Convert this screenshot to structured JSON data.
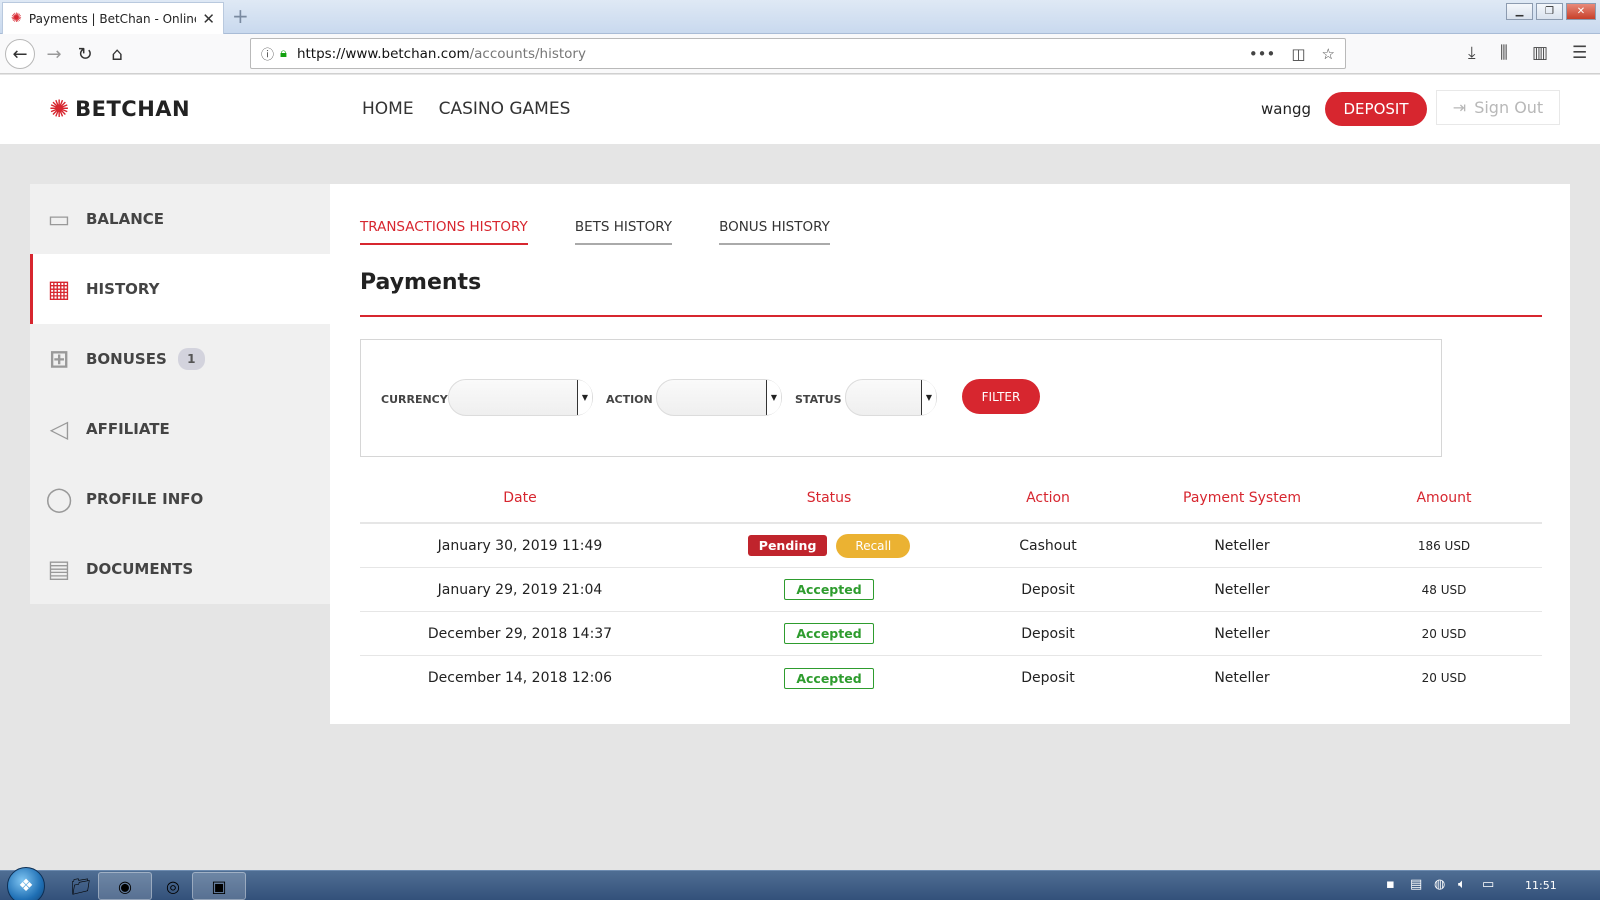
{
  "browser": {
    "tab_title": "Payments | BetChan - Online C",
    "url_domain": "https://www.betchan.com",
    "url_path": "/accounts/history"
  },
  "header": {
    "logo_text": "BETCHAN",
    "nav": [
      "HOME",
      "CASINO GAMES"
    ],
    "username": "wangg",
    "deposit_label": "DEPOSIT",
    "signout_label": "Sign Out"
  },
  "sidebar": {
    "items": [
      {
        "label": "BALANCE",
        "icon": "wallet-icon",
        "active": false
      },
      {
        "label": "HISTORY",
        "icon": "calendar-clock-icon",
        "active": true
      },
      {
        "label": "BONUSES",
        "icon": "gift-icon",
        "badge": "1",
        "active": false
      },
      {
        "label": "AFFILIATE",
        "icon": "megaphone-icon",
        "active": false
      },
      {
        "label": "PROFILE INFO",
        "icon": "user-icon",
        "active": false
      },
      {
        "label": "DOCUMENTS",
        "icon": "id-card-icon",
        "active": false
      }
    ]
  },
  "main": {
    "tabs": [
      {
        "label": "TRANSACTIONS HISTORY",
        "active": true
      },
      {
        "label": "BETS HISTORY",
        "active": false
      },
      {
        "label": "BONUS HISTORY",
        "active": false
      }
    ],
    "title": "Payments",
    "filters": {
      "currency_label": "CURRENCY",
      "action_label": "ACTION",
      "status_label": "STATUS",
      "filter_button": "FILTER"
    },
    "table": {
      "headers": [
        "Date",
        "Status",
        "Action",
        "Payment System",
        "Amount"
      ],
      "rows": [
        {
          "date": "January 30, 2019 11:49",
          "status": "Pending",
          "recall": "Recall",
          "action": "Cashout",
          "system": "Neteller",
          "amount": "186 USD"
        },
        {
          "date": "January 29, 2019 21:04",
          "status": "Accepted",
          "action": "Deposit",
          "system": "Neteller",
          "amount": "48 USD"
        },
        {
          "date": "December 29, 2018 14:37",
          "status": "Accepted",
          "action": "Deposit",
          "system": "Neteller",
          "amount": "20 USD"
        },
        {
          "date": "December 14, 2018 12:06",
          "status": "Accepted",
          "action": "Deposit",
          "system": "Neteller",
          "amount": "20 USD"
        }
      ]
    }
  },
  "taskbar": {
    "clock": "11:51"
  },
  "colors": {
    "brand_red": "#d7262f",
    "accepted_green": "#2e9c2e",
    "recall_orange": "#ebb232"
  }
}
